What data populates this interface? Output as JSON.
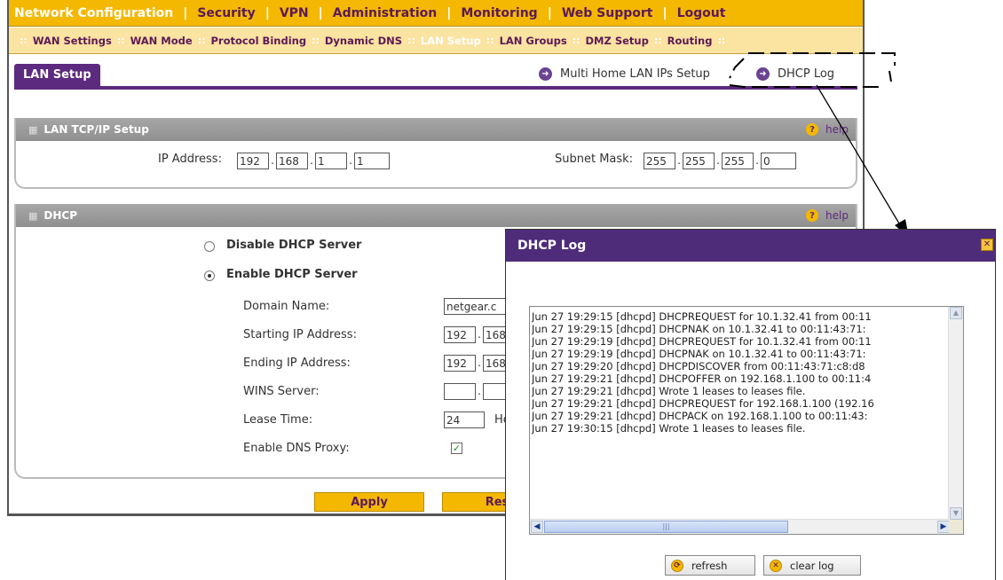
{
  "menu_primary": [
    "Network Configuration",
    "Security",
    "VPN",
    "Administration",
    "Monitoring",
    "Web Support",
    "Logout"
  ],
  "menu_secondary": [
    "WAN Settings",
    "WAN Mode",
    "Protocol Binding",
    "Dynamic DNS",
    "LAN Setup",
    "LAN Groups",
    "DMZ Setup",
    "Routing"
  ],
  "page": {
    "tab": "LAN Setup",
    "link_multihome": "Multi Home LAN IPs Setup",
    "link_dhcp_log": "DHCP Log"
  },
  "tcpip": {
    "header": "LAN TCP/IP Setup",
    "help": "help",
    "ip_label": "IP Address:",
    "ip": [
      "192",
      "168",
      "1",
      "1"
    ],
    "mask_label": "Subnet Mask:",
    "mask": [
      "255",
      "255",
      "255",
      "0"
    ]
  },
  "dhcp": {
    "header": "DHCP",
    "help": "help",
    "disable_label": "Disable DHCP Server",
    "enable_label": "Enable DHCP Server",
    "selected": "enable",
    "domain_label": "Domain Name:",
    "domain_value": "netgear.c",
    "start_label": "Starting IP Address:",
    "start_ip": [
      "192",
      "168"
    ],
    "end_label": "Ending IP Address:",
    "end_ip": [
      "192",
      "168"
    ],
    "wins_label": "WINS Server:",
    "wins": [
      "",
      ""
    ],
    "lease_label": "Lease Time:",
    "lease_value": "24",
    "lease_unit": "Ho",
    "dns_proxy_label": "Enable DNS Proxy:",
    "dns_proxy_checked": true
  },
  "buttons": {
    "apply": "Apply",
    "reset": "Res"
  },
  "dialog": {
    "title": "DHCP Log",
    "close_glyph": "✕",
    "log_lines": [
      "Jun 27 19:29:15 [dhcpd] DHCPREQUEST for 10.1.32.41 from 00:11",
      "Jun 27 19:29:15 [dhcpd] DHCPNAK on 10.1.32.41 to 00:11:43:71:",
      "Jun 27 19:29:19 [dhcpd] DHCPREQUEST for 10.1.32.41 from 00:11",
      "Jun 27 19:29:19 [dhcpd] DHCPNAK on 10.1.32.41 to 00:11:43:71:",
      "Jun 27 19:29:20 [dhcpd] DHCPDISCOVER from 00:11:43:71:c8:d8",
      "Jun 27 19:29:21 [dhcpd] DHCPOFFER on 192.168.1.100 to 00:11:4",
      "Jun 27 19:29:21 [dhcpd] Wrote 1 leases to leases file.",
      "Jun 27 19:29:21 [dhcpd] DHCPREQUEST for 192.168.1.100 (192.16",
      "Jun 27 19:29:21 [dhcpd] DHCPACK on 192.168.1.100 to 00:11:43:",
      "Jun 27 19:30:15 [dhcpd] Wrote 1 leases to leases file."
    ],
    "refresh": "refresh",
    "clear_log": "clear log"
  },
  "icons": {
    "arrow": "arrow-circle-icon",
    "help": "help-icon",
    "close": "close-icon",
    "refresh": "refresh-icon",
    "clear": "clear-icon"
  },
  "colors": {
    "menu_gold": "#f5b800",
    "submenu": "#fbe3a2",
    "purple": "#5c2a7e",
    "dialog_title": "#4e2c7a"
  }
}
